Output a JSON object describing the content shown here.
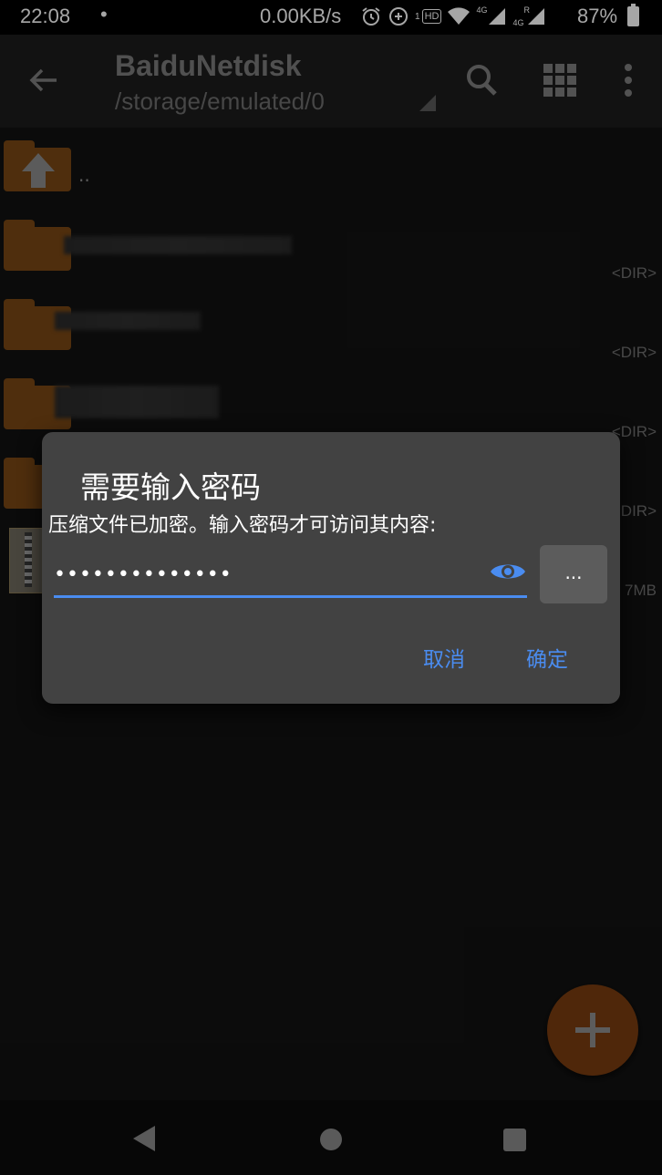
{
  "status_bar": {
    "time": "22:08",
    "dot": "•",
    "net_speed": "0.00KB/s",
    "sim1": "4G",
    "sim2": "4G",
    "sim_roaming": "R",
    "sim_slot": "1",
    "hd_label": "HD",
    "battery": "87%"
  },
  "app_bar": {
    "title": "BaiduNetdisk",
    "path": "/storage/emulated/0"
  },
  "file_list": {
    "parent_label": "..",
    "items": [
      {
        "tag": "<DIR>"
      },
      {
        "tag": "<DIR>"
      },
      {
        "tag": "<DIR>"
      },
      {
        "tag": "<DIR>"
      },
      {
        "tag": "7MB"
      }
    ]
  },
  "dialog": {
    "title": "需要输入密码",
    "message": "压缩文件已加密。输入密码才可访问其内容:",
    "password_value": "••••••••••••••",
    "more_button": "...",
    "cancel": "取消",
    "ok": "确定"
  },
  "colors": {
    "accent": "#4a8cf0",
    "folder": "#7a4714",
    "fab": "#7a3d10"
  }
}
